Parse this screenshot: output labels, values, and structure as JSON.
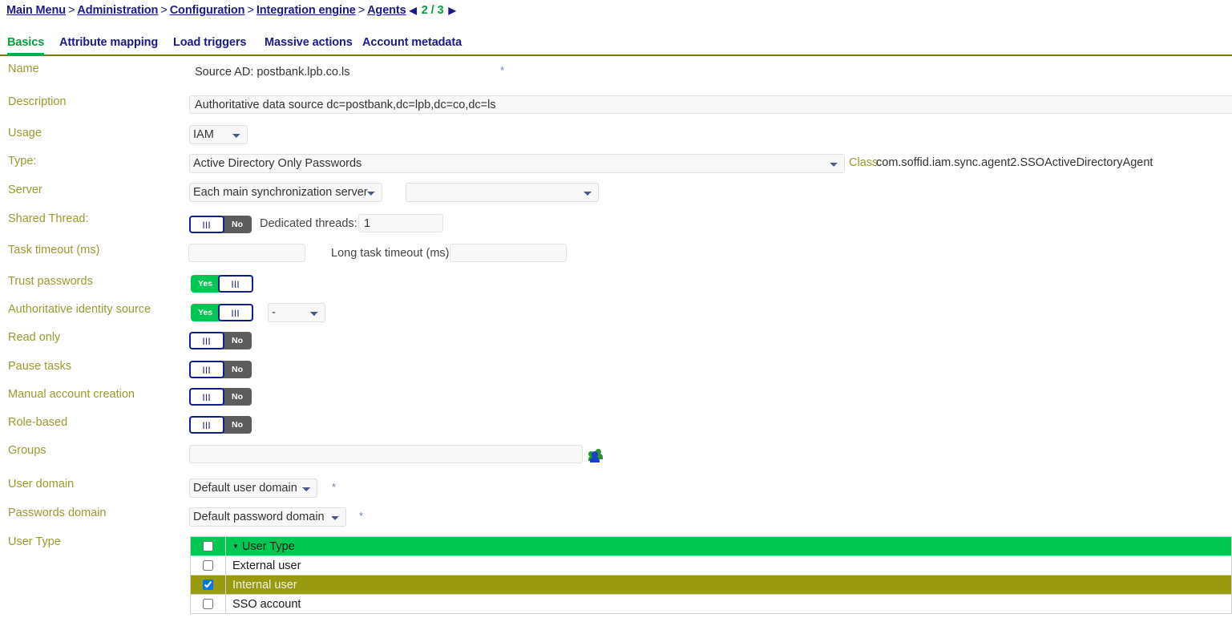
{
  "breadcrumb": {
    "items": [
      "Main Menu",
      "Administration",
      "Configuration",
      "Integration engine",
      "Agents"
    ],
    "separator": ">",
    "prev_arrow": "◀",
    "next_arrow": "▶",
    "pager": "2 / 3"
  },
  "tabs": [
    {
      "label": "Basics",
      "active": true
    },
    {
      "label": "Attribute mapping",
      "active": false
    },
    {
      "label": "Load triggers",
      "active": false
    },
    {
      "label": "Massive actions",
      "active": false
    },
    {
      "label": "Account metadata",
      "active": false
    }
  ],
  "form": {
    "name": {
      "label": "Name",
      "value": "Source AD: postbank.lpb.co.ls",
      "required_mark": "*"
    },
    "description": {
      "label": "Description",
      "value": "Authoritative data source dc=postbank,dc=lpb,dc=co,dc=ls"
    },
    "usage": {
      "label": "Usage",
      "value": "IAM",
      "options": [
        "IAM"
      ]
    },
    "type": {
      "label": "Type:",
      "value": "Active Directory Only Passwords",
      "options": [
        "Active Directory Only Passwords"
      ],
      "class_label": "Class:",
      "class_value": "com.soffid.iam.sync.agent2.SSOActiveDirectoryAgent"
    },
    "server": {
      "label": "Server",
      "value": "Each main synchronization server",
      "options": [
        "Each main synchronization server"
      ],
      "secondary_value": "",
      "secondary_options": [
        ""
      ]
    },
    "shared_thread": {
      "label": "Shared Thread:",
      "state": "No",
      "dedicated_threads_label": "Dedicated threads:",
      "dedicated_threads_value": "1"
    },
    "task_timeout": {
      "label": "Task timeout (ms)",
      "value": "",
      "long_label": "Long task timeout (ms):",
      "long_value": ""
    },
    "trust_passwords": {
      "label": "Trust passwords",
      "state": "Yes"
    },
    "authoritative_identity_source": {
      "label": "Authoritative identity source",
      "state": "Yes",
      "select_value": "-",
      "select_options": [
        "-"
      ]
    },
    "read_only": {
      "label": "Read only",
      "state": "No"
    },
    "pause_tasks": {
      "label": "Pause tasks",
      "state": "No"
    },
    "manual_account_creation": {
      "label": "Manual account creation",
      "state": "No"
    },
    "role_based": {
      "label": "Role-based",
      "state": "No"
    },
    "groups": {
      "label": "Groups",
      "value": "",
      "picker_icon": "group-people-icon"
    },
    "user_domain": {
      "label": "User domain",
      "value": "Default user domain",
      "options": [
        "Default user domain"
      ],
      "required_mark": "*"
    },
    "passwords_domain": {
      "label": "Passwords domain",
      "value": "Default password domain",
      "options": [
        "Default password domain"
      ],
      "required_mark": "*"
    },
    "user_type": {
      "label": "User Type",
      "column_header": "User Type",
      "rows": [
        {
          "name": "External user",
          "checked": false,
          "selected": false
        },
        {
          "name": "Internal user",
          "checked": true,
          "selected": true
        },
        {
          "name": "SSO account",
          "checked": false,
          "selected": false
        }
      ]
    }
  },
  "colors": {
    "label": "#9a9a2e",
    "link": "#1a1a8c",
    "accent_green": "#00b04c",
    "toggle_on": "#00c853",
    "toggle_off": "#5c5c5c",
    "row_selected": "#9a9a10",
    "tab_underline": "#7a7a10"
  }
}
